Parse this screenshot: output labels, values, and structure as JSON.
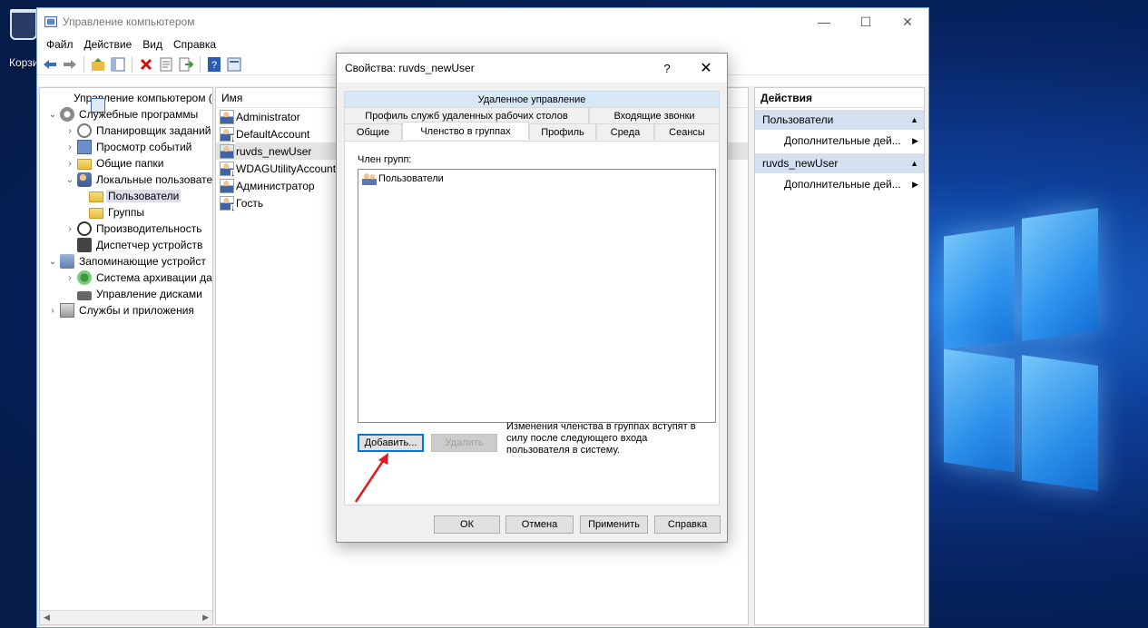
{
  "desktop": {
    "recycle_bin_label": "Корзи"
  },
  "window": {
    "title": "Управление компьютером",
    "controls": {
      "minimize": "—",
      "maximize": "☐",
      "close": "✕"
    }
  },
  "menu": {
    "items": [
      "Файл",
      "Действие",
      "Вид",
      "Справка"
    ]
  },
  "toolbar": {
    "icons": [
      "back-icon",
      "forward-icon",
      "up-icon",
      "show-hide-tree-icon",
      "delete-icon",
      "properties-icon",
      "export-icon",
      "help-icon",
      "console-icon"
    ]
  },
  "tree": {
    "items": [
      {
        "label": "Управление компьютером (л",
        "icon": "mmc"
      },
      {
        "label": "Служебные программы",
        "icon": "gear"
      },
      {
        "label": "Планировщик заданий",
        "icon": "clock"
      },
      {
        "label": "Просмотр событий",
        "icon": "log"
      },
      {
        "label": "Общие папки",
        "icon": "folder"
      },
      {
        "label": "Локальные пользовате",
        "icon": "users"
      },
      {
        "label": "Пользователи",
        "icon": "folder"
      },
      {
        "label": "Группы",
        "icon": "folder"
      },
      {
        "label": "Производительность",
        "icon": "perf"
      },
      {
        "label": "Диспетчер устройств",
        "icon": "dev"
      },
      {
        "label": "Запоминающие устройст",
        "icon": "storage"
      },
      {
        "label": "Система архивации да",
        "icon": "backup"
      },
      {
        "label": "Управление дисками",
        "icon": "disk"
      },
      {
        "label": "Службы и приложения",
        "icon": "svc"
      }
    ]
  },
  "list": {
    "header": "Имя",
    "rows": [
      "Administrator",
      "DefaultAccount",
      "ruvds_newUser",
      "WDAGUtilityAccount",
      "Администратор",
      "Гость"
    ]
  },
  "actions": {
    "header": "Действия",
    "sections": [
      {
        "title": "Пользователи",
        "item": "Дополнительные дей..."
      },
      {
        "title": "ruvds_newUser",
        "item": "Дополнительные дей..."
      }
    ]
  },
  "dialog": {
    "title": "Свойства: ruvds_newUser",
    "help": "?",
    "close": "✕",
    "tabs_row1": [
      "Удаленное управление"
    ],
    "tabs_row2": [
      "Профиль служб удаленных рабочих столов",
      "Входящие звонки"
    ],
    "tabs_row3": [
      "Общие",
      "Членство в группах",
      "Профиль",
      "Среда",
      "Сеансы"
    ],
    "active_tab": "Членство в группах",
    "member_label": "Член групп:",
    "members": [
      "Пользователи"
    ],
    "add_button": "Добавить...",
    "remove_button": "Удалить",
    "note": "Изменения членства в группах вступят в силу после следующего входа пользователя в систему.",
    "ok_button": "ОК",
    "cancel_button": "Отмена",
    "apply_button": "Применить",
    "help_button": "Справка"
  },
  "colors": {
    "accent": "#0078d7",
    "annotation_arrow": "#e0191c",
    "actions_section": "#d4e0f0"
  }
}
